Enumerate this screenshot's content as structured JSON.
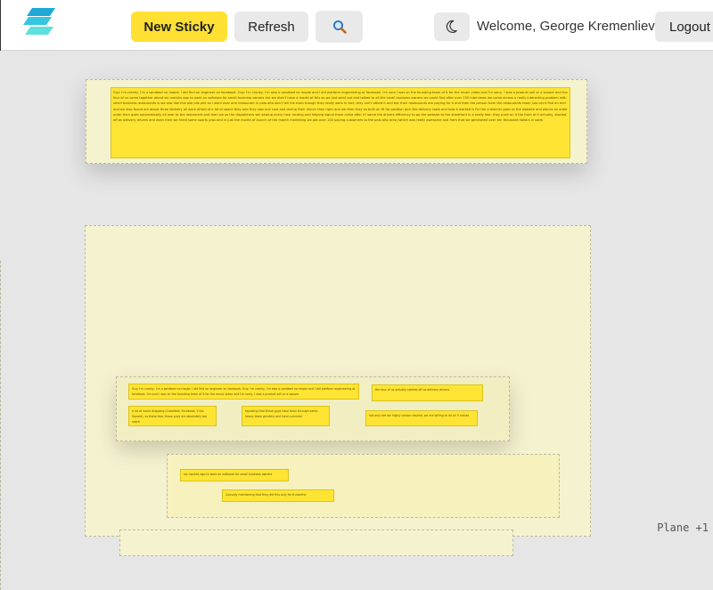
{
  "header": {
    "new_sticky_label": "New Sticky",
    "refresh_label": "Refresh",
    "search_icon": "search-icon",
    "theme_icon": "moon-icon",
    "welcome_text": "Welcome, George Kremenliev!",
    "logout_label": "Logout",
    "accent_color": "#ffe033"
  },
  "board": {
    "notes": {
      "top": "Guy: I'm cranky, I'm a sandbed no maple. I did find an engineer on facebook. Guy: I'm cranky, I'm also a sandbed no maple and I did platform engineering at facebook. I'm sure I was on the founding team of it for the music video and I'm sorry, I was a product sell or a square and the four of us came together about six months ago to work on software for small business owners but we didn't have a model of this as we just went out and talked to all the small business owners we could find after over 150 interviews we came across a really interesting problem with small business restaurants is we saw like this pile pile pile so I went over one restaurant in palo alto don't tell me even though they really were in fact, they can't afford it and but their restaurants are paying for it and then the person from the restaurants team just can't find an end and we also found out about three delivery all were afraid of a lot of space they and they saw one cost and during their dinner they right and we then they so built on fit fat position pick like delivery tools and how it worked is for the customer goes to the website and places an order order then goes automatically all over to the restaurant and then we as the dispatchers will sewing every hour routing and helping signal them come after it! some the drivers efficiency to go the website to the storefront in a really fast. they push on it the front of it actually, started off as delivery drivers and even then we hired some sports pros and in just the month of launch of the month marketing we got over 100 paying customers to the palo alto area (which was really awesome and from that we generated over ten thousand dollars in sales",
      "a": "Guy: I'm cranky, I'm a sandbed no maple. I did find an engineer on facebook. Guy: I'm cranky, I'm also a sandbed no maple and I did platform engineering at facebook. I'm sure I was on the founding team of it for the music video and I'm sorry, I was a product sell or a square",
      "b": "the four of us actually started off as delivery drivers",
      "c": "a lot of name dropping (Crowfield, Facebook, Y bio Square), so these two, those guys are absolutely top notch",
      "d": "signaling that these guys have been through some heavy team grinders and have survived",
      "e": "not only are we highly carbon neutral, we are willing to do all 5 values",
      "f": "six months ago to work on software for small business owners",
      "g": "Causally mentioning that they did this only for 6 months"
    }
  },
  "footer": {
    "plane_label": "Plane +1"
  }
}
